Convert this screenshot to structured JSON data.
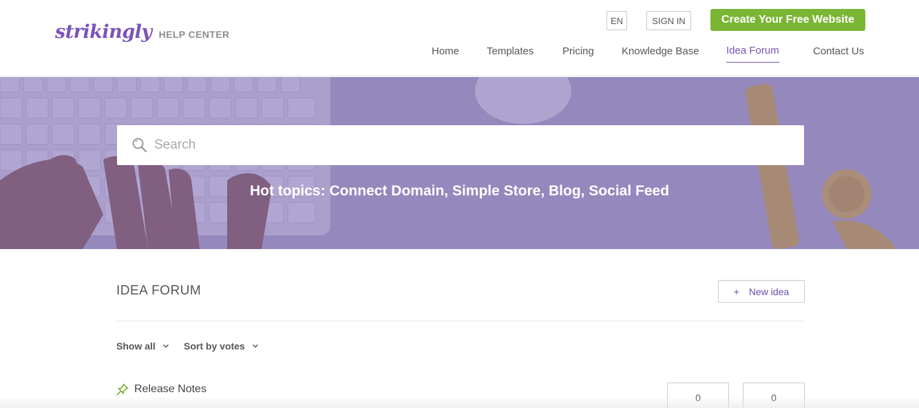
{
  "header": {
    "logo_text": "strikingly",
    "logo_subtitle": "HELP CENTER",
    "lang_label": "EN",
    "signin_label": "SIGN IN",
    "cta_label": "Create Your Free Website",
    "nav": [
      {
        "label": "Home"
      },
      {
        "label": "Templates"
      },
      {
        "label": "Pricing"
      },
      {
        "label": "Knowledge Base"
      },
      {
        "label": "Idea Forum",
        "active": true
      },
      {
        "label": "Contact Us"
      }
    ]
  },
  "hero": {
    "search_placeholder": "Search",
    "hot_topics": "Hot topics: Connect Domain, Simple Store, Blog, Social Feed"
  },
  "forum": {
    "title": "IDEA FORUM",
    "new_idea_icon": "+",
    "new_idea_label": "New idea",
    "filter_show": "Show all",
    "filter_sort": "Sort by votes",
    "topic": {
      "icon": "pin-icon",
      "label": "Release Notes",
      "vote_count_1": "0",
      "vote_count_2": "0"
    }
  },
  "colors": {
    "brand_purple": "#7a53b8",
    "cta_green": "#7ab534",
    "hero_overlay": "#7864af"
  }
}
